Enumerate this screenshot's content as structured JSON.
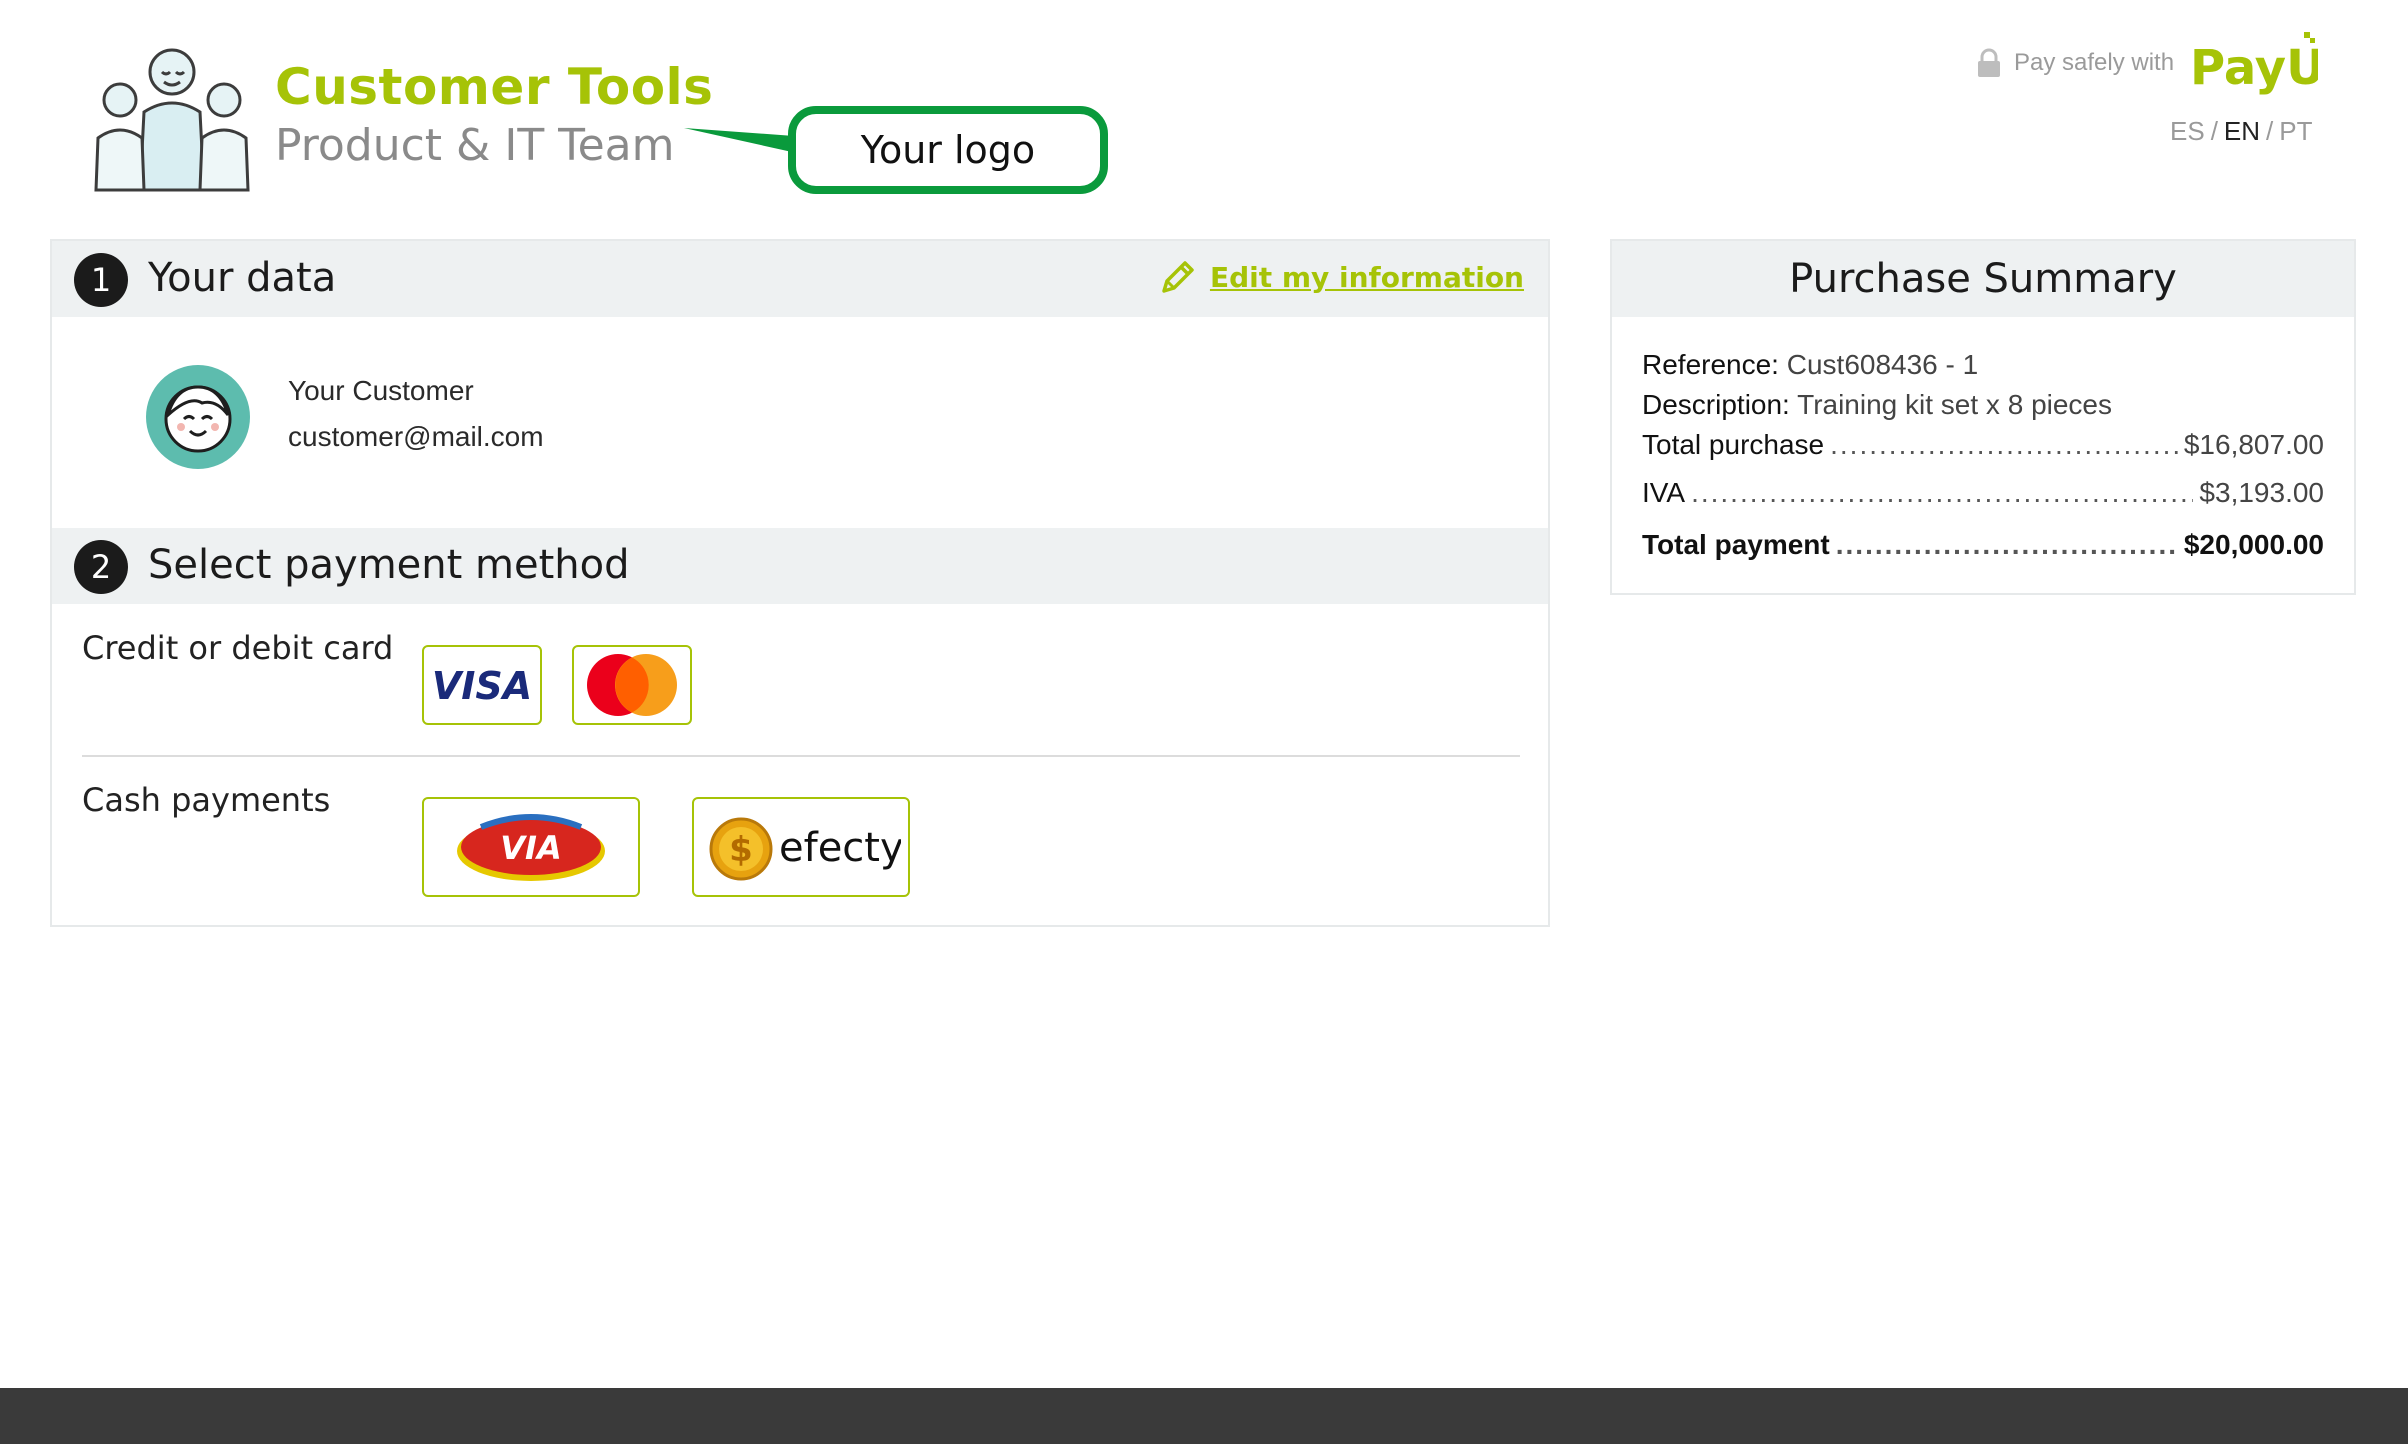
{
  "header": {
    "brand_title": "Customer Tools",
    "brand_subtitle": "Product & IT Team",
    "logo_placeholder": "Your logo",
    "pay_safely": "Pay safely with",
    "payu_logo": "PayU",
    "languages": [
      "ES",
      "EN",
      "PT"
    ],
    "active_language": "EN"
  },
  "your_data": {
    "step": "1",
    "title": "Your data",
    "edit_label": "Edit my information",
    "customer_name": "Your Customer",
    "customer_email": "customer@mail.com"
  },
  "payment": {
    "step": "2",
    "title": "Select payment method",
    "groups": [
      {
        "label": "Credit or debit card",
        "methods": [
          "VISA",
          "Mastercard"
        ]
      },
      {
        "label": "Cash payments",
        "methods": [
          "VIA",
          "efecty"
        ]
      }
    ],
    "visa_text": "VISA",
    "via_text": "VIA",
    "efecty_text": "efecty"
  },
  "summary": {
    "title": "Purchase Summary",
    "reference_label": "Reference:",
    "reference_value": "Cust608436 - 1",
    "description_label": "Description:",
    "description_value": "Training kit set x 8 pieces",
    "total_purchase_label": "Total purchase",
    "total_purchase_value": "$16,807.00",
    "iva_label": "IVA",
    "iva_value": "$3,193.00",
    "total_payment_label": "Total payment",
    "total_payment_value": "$20,000.00"
  },
  "colors": {
    "accent": "#a6c307",
    "callout_green": "#0a9a3c",
    "avatar_teal": "#5dbcae",
    "footer": "#3a3a3a"
  },
  "icons": [
    "lock-icon",
    "pencil-icon",
    "avatar-icon",
    "team-illustration"
  ]
}
